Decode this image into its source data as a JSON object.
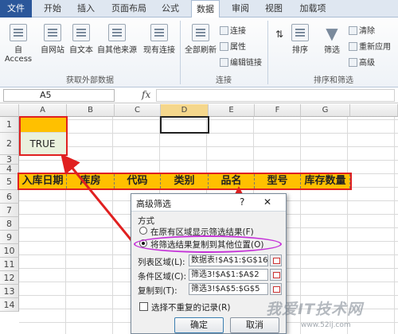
{
  "tabs": [
    "文件",
    "开始",
    "插入",
    "页面布局",
    "公式",
    "数据",
    "审阅",
    "视图",
    "加载项"
  ],
  "ribbon": {
    "ext_data": [
      "自 Access",
      "自网站",
      "自文本",
      "自其他来源",
      "现有连接"
    ],
    "ext_group": "获取外部数据",
    "refresh": "全部刷新",
    "conn_items": [
      "连接",
      "属性",
      "编辑链接"
    ],
    "conn_group": "连接",
    "sort_az": "A↓Z",
    "sort_label": "排序",
    "filter_label": "筛选",
    "filter_items": [
      "清除",
      "重新应用",
      "高级"
    ],
    "sort_group": "排序和筛选"
  },
  "formula_bar": {
    "name_box": "A5",
    "fx": "fx"
  },
  "columns": [
    "A",
    "B",
    "C",
    "D",
    "E",
    "F",
    "G"
  ],
  "rows": [
    "1",
    "2",
    "3",
    "4",
    "5",
    "6",
    "7",
    "8",
    "9",
    "10",
    "11",
    "12",
    "13",
    "14"
  ],
  "cell_a2": "TRUE",
  "header_row": [
    "入库日期",
    "库房",
    "代码",
    "类别",
    "品名",
    "型号",
    "库存数量"
  ],
  "dialog": {
    "title": "高级筛选",
    "help": "?",
    "close": "✕",
    "section": "方式",
    "option1": "在原有区域显示筛选结果(F)",
    "option2": "将筛选结果复制到其他位置(O)",
    "list_label": "列表区域(L):",
    "list_value": "数据表!$A$1:$G$16",
    "criteria_label": "条件区域(C):",
    "criteria_value": "筛选3!$A$1:$A$2",
    "copy_label": "复制到(T):",
    "copy_value": "筛选3!$A$5:$G$5",
    "unique_label": "选择不重复的记录(R)",
    "ok": "确定",
    "cancel": "取消"
  },
  "watermark": "我爱IT技术网",
  "watermark_url": "www.52ij.com",
  "colors": {
    "accent": "#2b579a",
    "header_fill": "#ffc000",
    "highlight": "#e02020",
    "ellipse": "#c430d8"
  }
}
